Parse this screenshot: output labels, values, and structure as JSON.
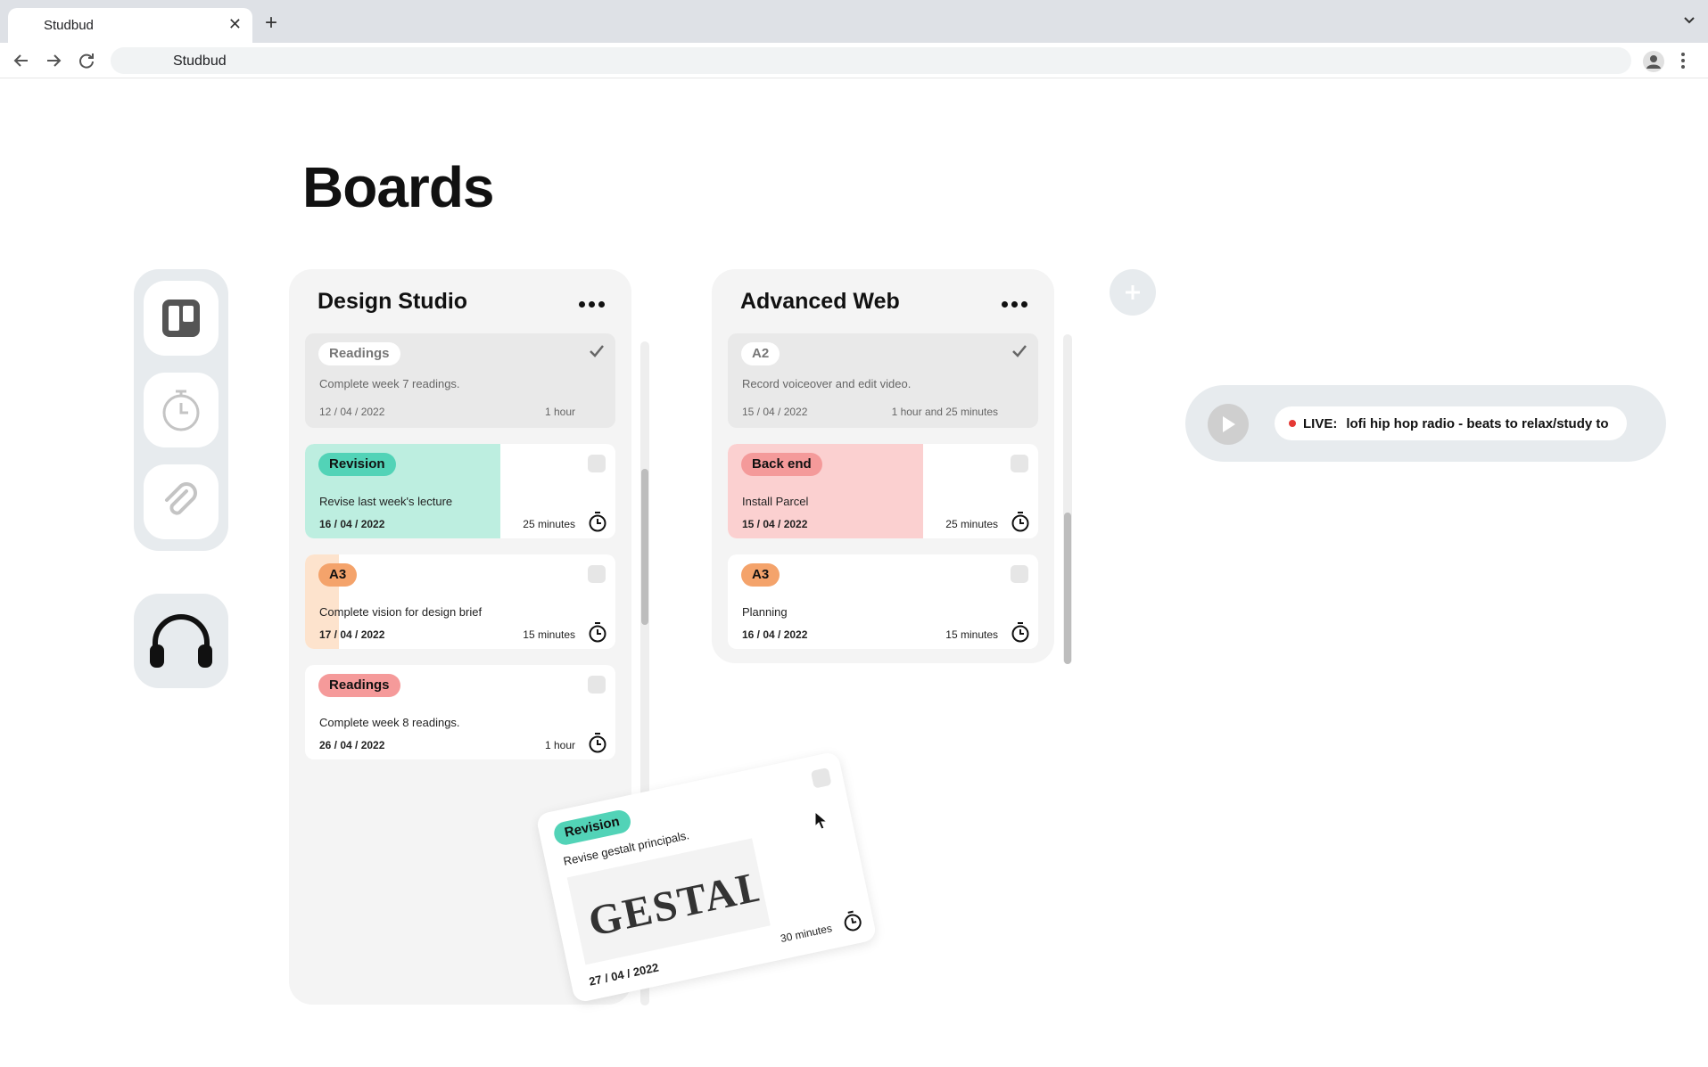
{
  "browser": {
    "tab_title": "Studbud",
    "tab_close": "✕",
    "new_tab": "+",
    "address": "Studbud"
  },
  "page": {
    "title": "Boards"
  },
  "sidebar": {
    "items": [
      {
        "name": "boards",
        "icon": "kanban-icon"
      },
      {
        "name": "timer",
        "icon": "stopwatch-icon"
      },
      {
        "name": "resources",
        "icon": "paperclip-icon"
      }
    ],
    "music_icon": "headphones-icon"
  },
  "boards": [
    {
      "title": "Design Studio",
      "cards": [
        {
          "tag": "Readings",
          "desc": "Complete week 7 readings.",
          "date": "12 / 04 / 2022",
          "duration": "1 hour",
          "done": true
        },
        {
          "tag": "Revision",
          "tag_color": "#52d3b7",
          "accent": "#bdeee0",
          "accent_progress": 0.63,
          "desc": "Revise last week's lecture",
          "date": "16 / 04 / 2022",
          "duration": "25 minutes",
          "done": false
        },
        {
          "tag": "A3",
          "tag_color": "#f4a36b",
          "accent": "#fde3cd",
          "accent_progress": 0.11,
          "desc": "Complete vision for design brief",
          "date": "17 / 04 / 2022",
          "duration": "15 minutes",
          "done": false
        },
        {
          "tag": "Readings",
          "tag_color": "#f59a9a",
          "desc": "Complete week 8 readings.",
          "date": "26 / 04 / 2022",
          "duration": "1 hour",
          "done": false
        }
      ]
    },
    {
      "title": "Advanced Web",
      "cards": [
        {
          "tag": "A2",
          "desc": "Record voiceover and edit video.",
          "date": "15 / 04 / 2022",
          "duration": "1 hour and 25 minutes",
          "done": true
        },
        {
          "tag": "Back end",
          "tag_color": "#f49a9a",
          "accent": "#fbd0d0",
          "accent_progress": 0.63,
          "desc": "Install Parcel",
          "date": "15 / 04 / 2022",
          "duration": "25 minutes",
          "done": false
        },
        {
          "tag": "A3",
          "tag_color": "#f4a36b",
          "desc": "Planning",
          "date": "16 / 04 / 2022",
          "duration": "15 minutes",
          "done": false
        }
      ]
    }
  ],
  "add_board_label": "+",
  "player": {
    "live_label": "LIVE:",
    "stream_title": "lofi hip hop radio - beats to relax/study to",
    "play_icon": "play-icon"
  },
  "dragged_card": {
    "tag": "Revision",
    "tag_color": "#52d3b7",
    "desc": "Revise gestalt principals.",
    "image_word": "GESTALT",
    "date": "27 / 04 / 2022",
    "duration": "30 minutes"
  }
}
